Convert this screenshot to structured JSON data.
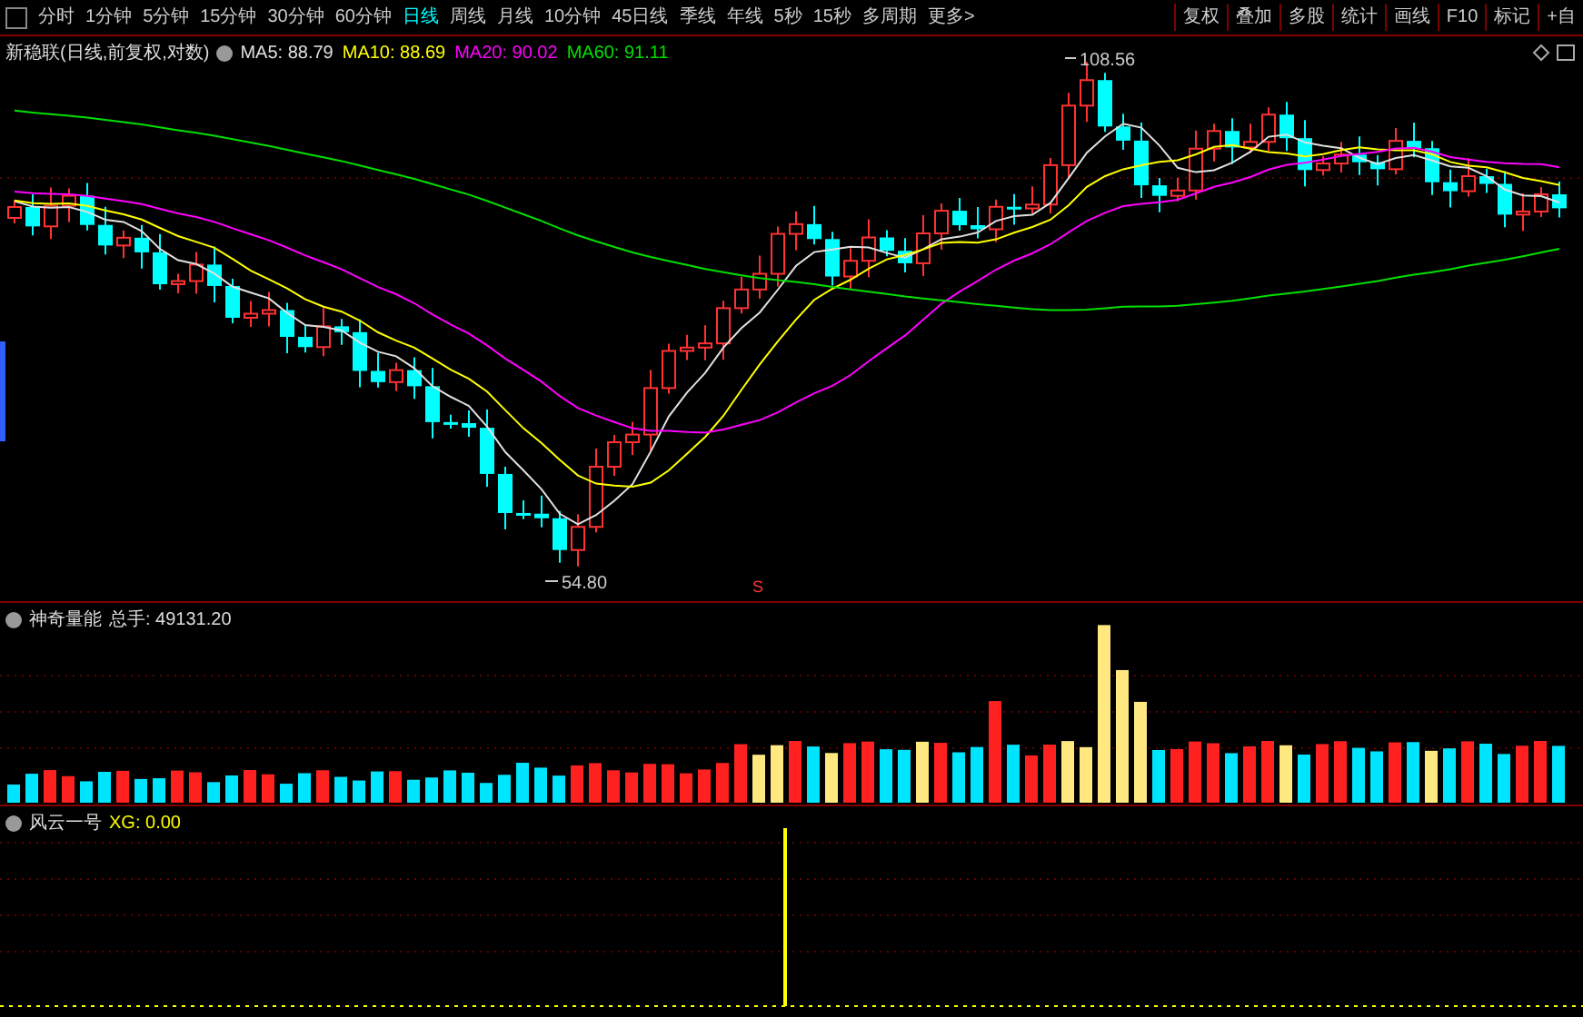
{
  "periods": [
    {
      "label": "分时",
      "selected": false
    },
    {
      "label": "1分钟",
      "selected": false
    },
    {
      "label": "5分钟",
      "selected": false
    },
    {
      "label": "15分钟",
      "selected": false
    },
    {
      "label": "30分钟",
      "selected": false
    },
    {
      "label": "60分钟",
      "selected": false
    },
    {
      "label": "日线",
      "selected": true
    },
    {
      "label": "周线",
      "selected": false
    },
    {
      "label": "月线",
      "selected": false
    },
    {
      "label": "10分钟",
      "selected": false
    },
    {
      "label": "45日线",
      "selected": false
    },
    {
      "label": "季线",
      "selected": false
    },
    {
      "label": "年线",
      "selected": false
    },
    {
      "label": "5秒",
      "selected": false
    },
    {
      "label": "15秒",
      "selected": false
    },
    {
      "label": "多周期",
      "selected": false
    },
    {
      "label": "更多>",
      "selected": false
    }
  ],
  "toolbar": [
    "复权",
    "叠加",
    "多股",
    "统计",
    "画线",
    "F10",
    "标记",
    "+自"
  ],
  "main_pane": {
    "title": "新稳联(日线,前复权,对数)",
    "ma_legend": [
      {
        "label": "MA5: 88.79",
        "color": "#e0e0e0"
      },
      {
        "label": "MA10: 88.69",
        "color": "#ffff00"
      },
      {
        "label": "MA20: 90.02",
        "color": "#ff00ff"
      },
      {
        "label": "MA60: 91.11",
        "color": "#00e000"
      }
    ],
    "high_label": "108.56",
    "low_label": "54.80",
    "marker": "S"
  },
  "volume_pane": {
    "name": "神奇量能",
    "reading": "总手: 49131.20"
  },
  "signal_pane": {
    "name": "风云一号",
    "reading": "XG: 0.00"
  }
}
